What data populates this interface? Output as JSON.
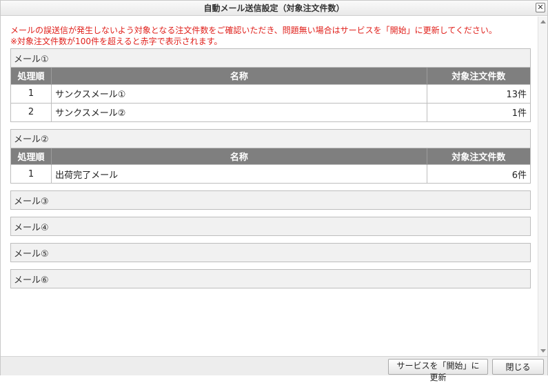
{
  "window": {
    "title": "自動メール送信設定（対象注文件数）",
    "close_glyph": "✕"
  },
  "notice": {
    "line1": "メールの誤送信が発生しないよう対象となる注文件数をご確認いただき、問題無い場合はサービスを「開始」に更新してください。",
    "line2": "※対象注文件数が100件を超えると赤字で表示されます。",
    "color": "#e0201b"
  },
  "table_headers": {
    "order": "処理順",
    "name": "名称",
    "count": "対象注文件数"
  },
  "sections": [
    {
      "title": "メール①",
      "rows": [
        {
          "order": "1",
          "name": "サンクスメール①",
          "count": "13件"
        },
        {
          "order": "2",
          "name": "サンクスメール②",
          "count": "1件"
        }
      ]
    },
    {
      "title": "メール②",
      "rows": [
        {
          "order": "1",
          "name": "出荷完了メール",
          "count": "6件"
        }
      ]
    },
    {
      "title": "メール③",
      "rows": []
    },
    {
      "title": "メール④",
      "rows": []
    },
    {
      "title": "メール⑤",
      "rows": []
    },
    {
      "title": "メール⑥",
      "rows": []
    }
  ],
  "footer": {
    "start_button": "サービスを「開始」に更新",
    "close_button": "閉じる"
  }
}
